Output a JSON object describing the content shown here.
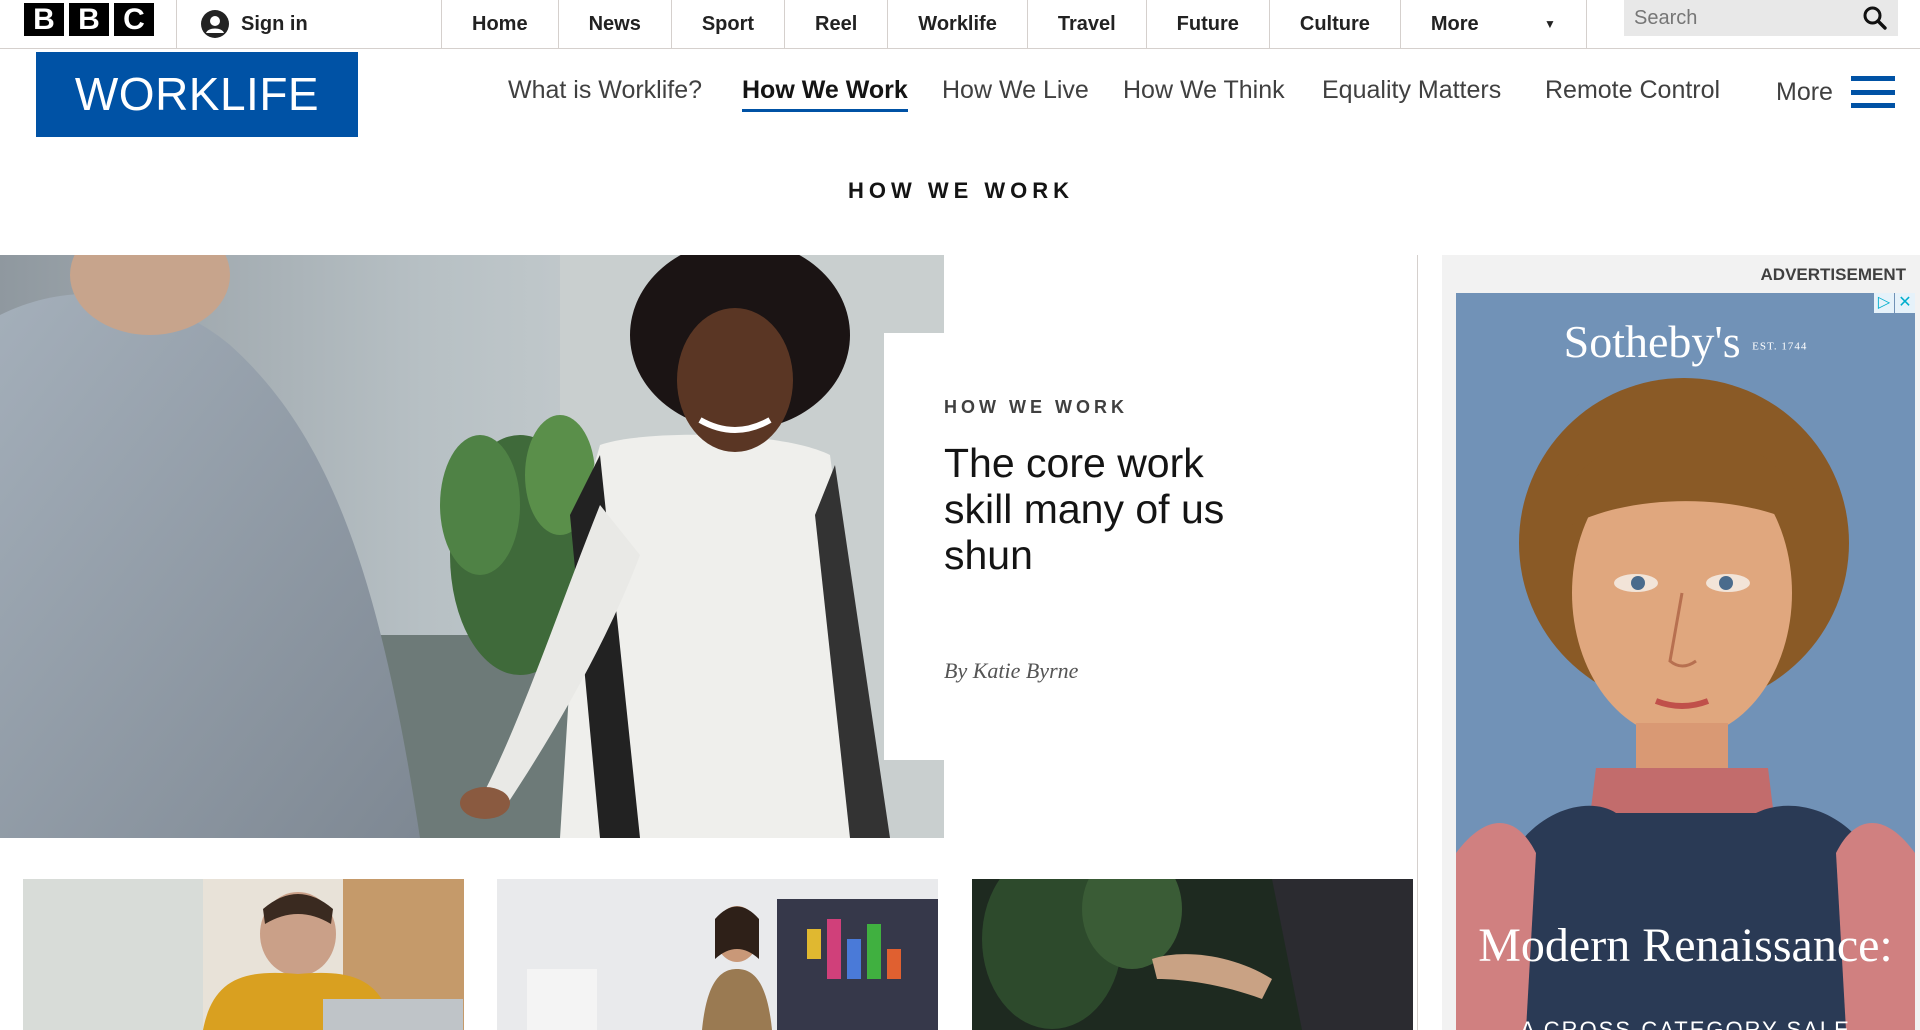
{
  "global_nav": {
    "brand": [
      "B",
      "B",
      "C"
    ],
    "sign_in": "Sign in",
    "items": [
      "Home",
      "News",
      "Sport",
      "Reel",
      "Worklife",
      "Travel",
      "Future",
      "Culture"
    ],
    "more": "More",
    "search_placeholder": "Search"
  },
  "section": {
    "logo": "WORKLIFE",
    "nav": [
      {
        "label": "What is Worklife?",
        "active": false
      },
      {
        "label": "How We Work",
        "active": true
      },
      {
        "label": "How We Live",
        "active": false
      },
      {
        "label": "How We Think",
        "active": false
      },
      {
        "label": "Equality Matters",
        "active": false
      },
      {
        "label": "Remote Control",
        "active": false
      }
    ],
    "more": "More"
  },
  "page_heading": "HOW WE WORK",
  "hero": {
    "kicker": "HOW WE WORK",
    "headline": "The core work skill many of us shun",
    "byline": "By Katie Byrne"
  },
  "ad": {
    "label": "ADVERTISEMENT",
    "brand": "Sotheby's",
    "brand_est": "EST. 1744",
    "title": "Modern Renaissance:",
    "subtitle": "A CROSS-CATEGORY SALE"
  },
  "colors": {
    "worklife_blue": "#0052a5",
    "text_dark": "#141414",
    "divider": "#d5d0cd"
  }
}
